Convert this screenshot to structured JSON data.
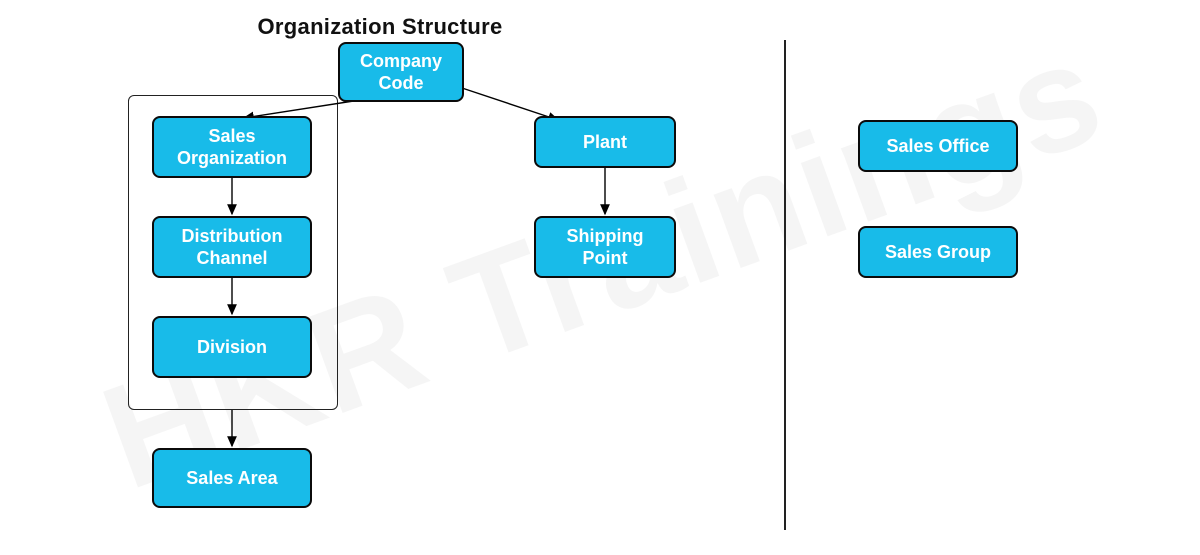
{
  "title": "Organization Structure",
  "watermark": "HKR Trainings",
  "nodes": {
    "company_code": "Company\nCode",
    "sales_org": "Sales\nOrganization",
    "dist_channel": "Distribution\nChannel",
    "division": "Division",
    "sales_area": "Sales Area",
    "plant": "Plant",
    "shipping_point": "Shipping\nPoint",
    "sales_office": "Sales Office",
    "sales_group": "Sales Group"
  },
  "colors": {
    "node_bg": "#18bbe9",
    "node_border": "#0b0b0b"
  },
  "edges": [
    {
      "from": "company_code",
      "to": "sales_org"
    },
    {
      "from": "company_code",
      "to": "plant"
    },
    {
      "from": "sales_org",
      "to": "dist_channel"
    },
    {
      "from": "dist_channel",
      "to": "division"
    },
    {
      "from": "division",
      "to": "sales_area"
    },
    {
      "from": "plant",
      "to": "shipping_point"
    }
  ],
  "groups": {
    "sales_area_group": [
      "sales_org",
      "dist_channel",
      "division"
    ]
  }
}
